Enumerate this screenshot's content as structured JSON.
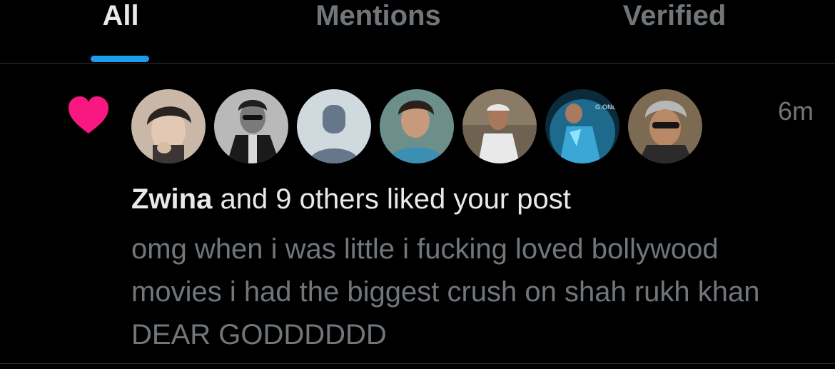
{
  "tabs": [
    {
      "label": "All",
      "active": true
    },
    {
      "label": "Mentions",
      "active": false
    },
    {
      "label": "Verified",
      "active": false
    }
  ],
  "accent_color": "#1d9bf0",
  "like_color": "#f91880",
  "notification": {
    "icon": "heart-icon",
    "timestamp": "6m",
    "liker_name": "Zwina",
    "summary_rest": " and 9 others liked your post",
    "post_text": "omg when i was little i fucking loved bollywood movies i had the biggest crush on shah rukh khan DEAR GODDDDDD",
    "avatars": [
      {
        "kind": "photo"
      },
      {
        "kind": "photo"
      },
      {
        "kind": "default"
      },
      {
        "kind": "photo"
      },
      {
        "kind": "photo"
      },
      {
        "kind": "photo"
      },
      {
        "kind": "photo"
      }
    ]
  }
}
